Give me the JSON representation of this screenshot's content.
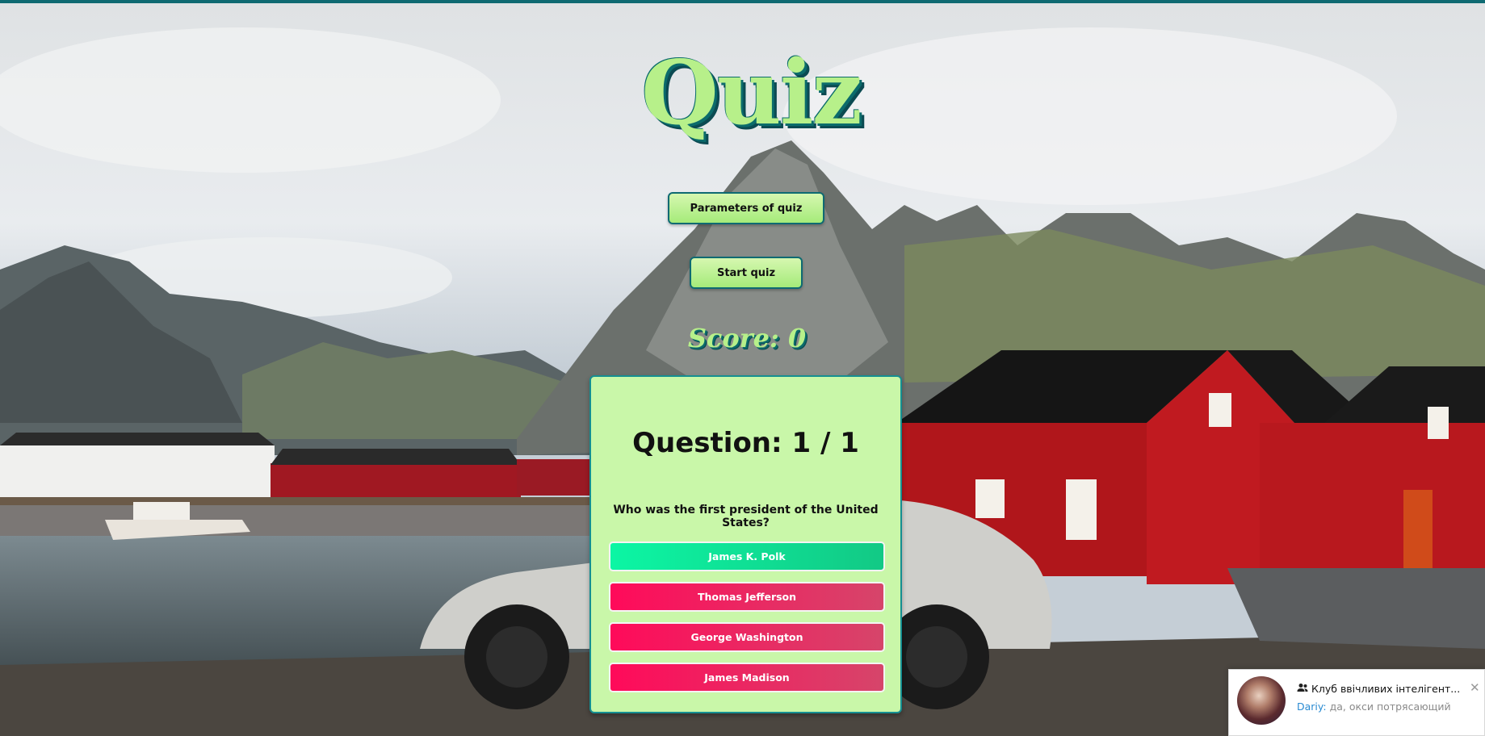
{
  "app": {
    "title": "Quiz",
    "parameters_button": "Parameters of quiz",
    "start_button": "Start quiz",
    "score": "Score: 0"
  },
  "quiz": {
    "question_header": "Question: 1 / 1",
    "question_text": "Who was the first president of the United States?",
    "answers": [
      {
        "label": "James K. Polk",
        "state": "green"
      },
      {
        "label": "Thomas Jefferson",
        "state": "red"
      },
      {
        "label": "George Washington",
        "state": "red"
      },
      {
        "label": "James Madison",
        "state": "red"
      }
    ]
  },
  "notification": {
    "group_icon": "group-icon",
    "chat_title": "Клуб ввічливих інтелігент...",
    "sender": "Dariy:",
    "message": "да, окси потрясающий",
    "close_symbol": "✕"
  },
  "colors": {
    "accent": "#0e6a72",
    "card_bg": "#c9f7a9",
    "answer_green": "#0cf6a4",
    "answer_red": "#ff0a5a"
  }
}
